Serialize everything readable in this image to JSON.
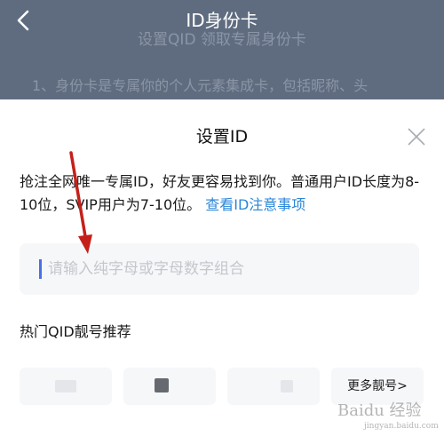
{
  "header": {
    "title": "ID身份卡",
    "subtitle": "设置QID 领取专属身份卡",
    "description": "1、身份卡是专属你的个人元素集成卡，包括昵称、头"
  },
  "dialog": {
    "title": "设置ID",
    "description": "抢注全网唯一专属ID，好友更容易找到你。普通用户ID长度为8-10位，SVIP用户为7-10位。",
    "link_text": "查看ID注意事项",
    "input": {
      "value": "",
      "placeholder": "请输入纯字母或字母数字组合"
    },
    "recommend_title": "热门QID靓号推荐",
    "more_label": "更多靓号>"
  },
  "watermark": {
    "text": "Baidu 经验",
    "subtext": "jingyan.baidu.com"
  },
  "colors": {
    "header_bg": "#5f6c80",
    "link": "#2a86d8",
    "caret": "#4a6fe8",
    "arrow": "#c4201a"
  },
  "icons": [
    "back-arrow-icon",
    "close-icon"
  ]
}
